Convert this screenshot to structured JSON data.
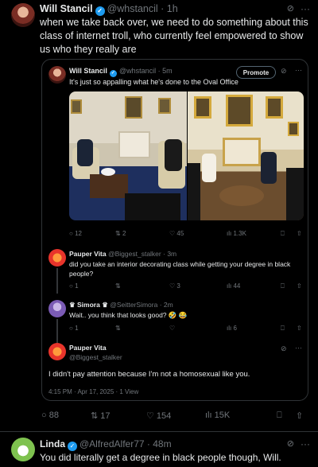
{
  "top_post": {
    "display_name": "Will Stancil",
    "handle": "@whstancil",
    "time": "1h",
    "text": "when we take back over, we need to do something about this class of internet troll, who currently feel empowered to show us who they really are"
  },
  "quoted_post": {
    "display_name": "Will Stancil",
    "handle": "@whstancil",
    "time": "5m",
    "text": "It's just so appalling what he's done to the Oval Office",
    "promote_label": "Promote",
    "stats": {
      "replies": "12",
      "reposts": "2",
      "likes": "45",
      "views": "1.3K"
    }
  },
  "replies": [
    {
      "display_name": "Pauper Vita",
      "handle": "@Biggest_stalker",
      "time": "3m",
      "text": "did you take an interior decorating class while getting your degree in black people?",
      "stats": {
        "replies": "1",
        "reposts": "",
        "likes": "3",
        "views": "44"
      }
    },
    {
      "display_name": "Simora",
      "handle": "@SeitterSimora",
      "time": "2m",
      "text": "Wait.. you think that looks good? 🤣 😂",
      "stats": {
        "replies": "1",
        "reposts": "",
        "likes": "",
        "views": "6"
      }
    },
    {
      "display_name": "Pauper Vita",
      "handle": "@Biggest_stalker",
      "text": "I didn't pay attention because I'm not a homosexual like you.",
      "timestamp": "4:15 PM · Apr 17, 2025 · 1 View"
    }
  ],
  "top_stats": {
    "replies": "88",
    "reposts": "17",
    "likes": "154",
    "views": "15K"
  },
  "reply": {
    "display_name": "Linda",
    "handle": "@AlfredAlfer77",
    "time": "48m",
    "text": "You did literally get a degree in black people though, Will."
  },
  "icons": {
    "reply": "reply-icon",
    "repost": "repost-icon",
    "like": "heart-icon",
    "views": "views-icon",
    "bookmark": "bookmark-icon",
    "share": "share-icon",
    "more": "more-icon",
    "grok": "grok-icon",
    "verified": "verified-badge-icon"
  },
  "colors": {
    "background": "#000000",
    "text": "#e7e9ea",
    "muted": "#71767b",
    "verified": "#1d9bf0",
    "border": "#2f3336"
  }
}
